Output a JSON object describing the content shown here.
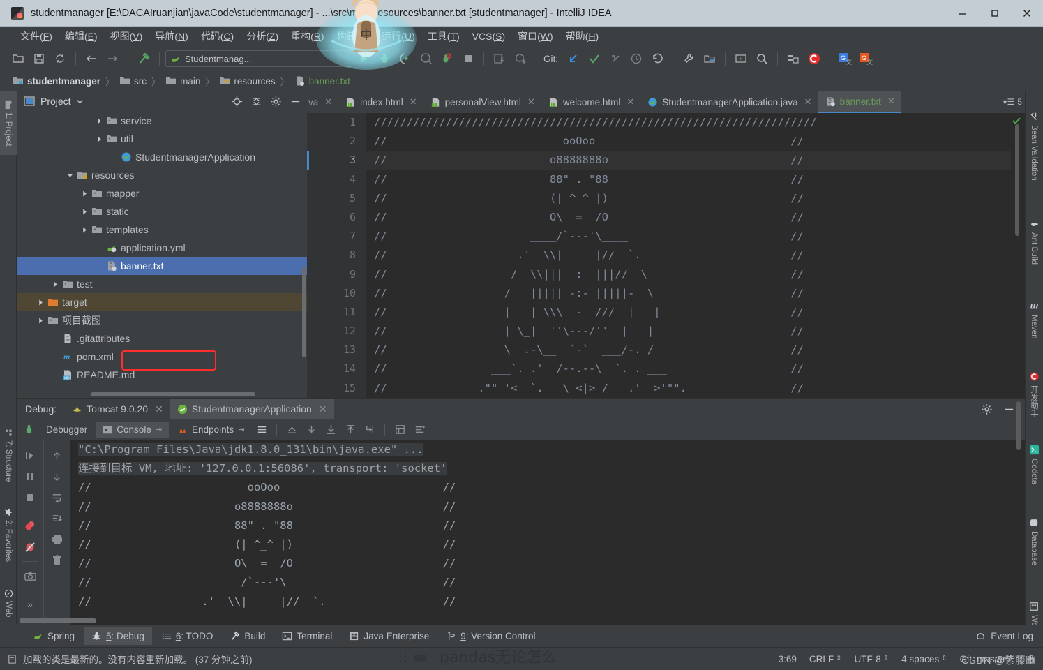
{
  "window": {
    "title": "studentmanager [E:\\DACAIruanjian\\javaCode\\studentmanager] - ...\\src\\main\\resources\\banner.txt [studentmanager] - IntelliJ IDEA",
    "minimize": "minimize-icon",
    "maximize": "maximize-icon",
    "close": "close-icon"
  },
  "menubar": [
    {
      "label": "文件(F)"
    },
    {
      "label": "编辑(E)"
    },
    {
      "label": "视图(V)"
    },
    {
      "label": "导航(N)"
    },
    {
      "label": "代码(C)"
    },
    {
      "label": "分析(Z)"
    },
    {
      "label": "重构(R)"
    },
    {
      "label": "构建(B)"
    },
    {
      "label": "运行(U)"
    },
    {
      "label": "工具(T)"
    },
    {
      "label": "VCS(S)"
    },
    {
      "label": "窗口(W)"
    },
    {
      "label": "帮助(H)"
    }
  ],
  "toolbar": {
    "run_configuration": "Studentmanag...",
    "git_label": "Git:"
  },
  "breadcrumbs": [
    {
      "label": "studentmanager",
      "style": "bold"
    },
    {
      "label": "src",
      "style": "normal"
    },
    {
      "label": "main",
      "style": "normal"
    },
    {
      "label": "resources",
      "style": "normal"
    },
    {
      "label": "banner.txt",
      "style": "green"
    }
  ],
  "left_stripe": [
    {
      "label": "1: Project",
      "active": true
    },
    {
      "label": "7: Structure",
      "active": false
    },
    {
      "label": "2: Favorites",
      "active": false
    },
    {
      "label": "Web",
      "active": false
    }
  ],
  "right_stripe": [
    {
      "label": "Bean Validation"
    },
    {
      "label": "Ant Build"
    },
    {
      "label": "Maven"
    },
    {
      "label": "开发助手"
    },
    {
      "label": "Codota"
    },
    {
      "label": "Database"
    },
    {
      "label": "Word Bo"
    }
  ],
  "project_panel": {
    "title": "Project",
    "tree": [
      {
        "label": "service",
        "indent": 5,
        "arrow": "right",
        "icon": "folder",
        "state": "normal"
      },
      {
        "label": "util",
        "indent": 5,
        "arrow": "right",
        "icon": "folder",
        "state": "normal"
      },
      {
        "label": "StudentmanagerApplication",
        "indent": 6,
        "arrow": "none",
        "icon": "spring-class",
        "state": "normal"
      },
      {
        "label": "resources",
        "indent": 3,
        "arrow": "down",
        "icon": "resources",
        "state": "normal"
      },
      {
        "label": "mapper",
        "indent": 4,
        "arrow": "right",
        "icon": "folder",
        "state": "normal"
      },
      {
        "label": "static",
        "indent": 4,
        "arrow": "right",
        "icon": "folder",
        "state": "normal"
      },
      {
        "label": "templates",
        "indent": 4,
        "arrow": "right",
        "icon": "folder",
        "state": "normal"
      },
      {
        "label": "application.yml",
        "indent": 5,
        "arrow": "none",
        "icon": "spring-yml",
        "state": "normal"
      },
      {
        "label": "banner.txt",
        "indent": 5,
        "arrow": "none",
        "icon": "spring-txt",
        "state": "selected"
      },
      {
        "label": "test",
        "indent": 2,
        "arrow": "right",
        "icon": "folder",
        "state": "normal"
      },
      {
        "label": "target",
        "indent": 1,
        "arrow": "right",
        "icon": "folder-orange",
        "state": "target"
      },
      {
        "label": "项目截图",
        "indent": 1,
        "arrow": "right",
        "icon": "folder",
        "state": "normal"
      },
      {
        "label": ".gitattributes",
        "indent": 2,
        "arrow": "none",
        "icon": "file",
        "state": "normal"
      },
      {
        "label": "pom.xml",
        "indent": 2,
        "arrow": "none",
        "icon": "maven",
        "state": "normal"
      },
      {
        "label": "README.md",
        "indent": 2,
        "arrow": "none",
        "icon": "markdown",
        "state": "normal"
      }
    ]
  },
  "editor": {
    "tabs": [
      {
        "label": "va",
        "icon": "java",
        "active": false,
        "clipped": true
      },
      {
        "label": "index.html",
        "icon": "html",
        "active": false
      },
      {
        "label": "personalView.html",
        "icon": "html",
        "active": false
      },
      {
        "label": "welcome.html",
        "icon": "html",
        "active": false
      },
      {
        "label": "StudentmanagerApplication.java",
        "icon": "spring-class",
        "active": false
      },
      {
        "label": "banner.txt",
        "icon": "spring-txt",
        "active": true
      }
    ],
    "tab_overflow_count": "5",
    "current_line": 3,
    "lines": [
      {
        "n": 1,
        "text": "////////////////////////////////////////////////////////////////////"
      },
      {
        "n": 2,
        "text": "//                          _ooOoo_                             //"
      },
      {
        "n": 3,
        "text": "//                         o8888888o                            //"
      },
      {
        "n": 4,
        "text": "//                         88\" . \"88                            //"
      },
      {
        "n": 5,
        "text": "//                         (| ^_^ |)                            //"
      },
      {
        "n": 6,
        "text": "//                         O\\  =  /O                            //"
      },
      {
        "n": 7,
        "text": "//                      ____/`---'\\____                         //"
      },
      {
        "n": 8,
        "text": "//                    .'  \\\\|     |//  `.                       //"
      },
      {
        "n": 9,
        "text": "//                   /  \\\\|||  :  |||//  \\                      //"
      },
      {
        "n": 10,
        "text": "//                  /  _||||| -:- |||||-  \\                     //"
      },
      {
        "n": 11,
        "text": "//                  |   | \\\\\\  -  ///  |   |                    //"
      },
      {
        "n": 12,
        "text": "//                  | \\_|  ''\\---/''  |   |                     //"
      },
      {
        "n": 13,
        "text": "//                  \\  .-\\__  `-`  ___/-. /                     //"
      },
      {
        "n": 14,
        "text": "//                ___`. .'  /--.--\\  `. . ___                   //"
      },
      {
        "n": 15,
        "text": "//              .\"\" '<  `.___\\_<|>_/___.'  >'\"\".                //"
      }
    ]
  },
  "debug": {
    "label": "Debug:",
    "sessions": [
      {
        "label": "Tomcat 9.0.20",
        "icon": "tomcat",
        "active": false
      },
      {
        "label": "StudentmanagerApplication",
        "icon": "spring",
        "active": true
      }
    ],
    "subtabs": [
      {
        "label": "Debugger",
        "icon": "",
        "active": false
      },
      {
        "label": "Console",
        "icon": "console-icon",
        "active": true
      },
      {
        "label": "Endpoints",
        "icon": "endpoints-icon",
        "active": false
      }
    ],
    "console_lines": [
      {
        "text": "\"C:\\Program Files\\Java\\jdk1.8.0_131\\bin\\java.exe\" ...",
        "type": "cmd"
      },
      {
        "text": "连接到目标 VM, 地址: '127.0.0.1:56086', transport: 'socket'",
        "type": "cmd"
      },
      {
        "text": "//                       _ooOoo_                        //",
        "type": "art"
      },
      {
        "text": "//                      o8888888o                       //",
        "type": "art"
      },
      {
        "text": "//                      88\" . \"88                       //",
        "type": "art"
      },
      {
        "text": "//                      (| ^_^ |)                       //",
        "type": "art"
      },
      {
        "text": "//                      O\\  =  /O                       //",
        "type": "art"
      },
      {
        "text": "//                   ____/`---'\\____                    //",
        "type": "art"
      },
      {
        "text": "//                 .'  \\\\|     |//  `.                  //",
        "type": "art"
      }
    ]
  },
  "bottom_tabs": [
    {
      "label": "Spring",
      "icon": "spring-leaf-icon",
      "active": false
    },
    {
      "label": "5: Debug",
      "icon": "bug-icon",
      "active": true
    },
    {
      "label": "6: TODO",
      "icon": "todo-icon",
      "active": false
    },
    {
      "label": "Build",
      "icon": "hammer-icon",
      "active": false
    },
    {
      "label": "Terminal",
      "icon": "terminal-icon",
      "active": false
    },
    {
      "label": "Java Enterprise",
      "icon": "java-ee-icon",
      "active": false
    },
    {
      "label": "9: Version Control",
      "icon": "vcs-icon",
      "active": false
    }
  ],
  "event_log": "Event Log",
  "statusbar": {
    "message": "加载的类是最新的。没有内容重新加载。 (37 分钟之前)",
    "caret": "3:69",
    "line_separator": "CRLF",
    "encoding": "UTF-8",
    "indent": "4 spaces",
    "branch": "Git: master"
  },
  "watermark": "CSDN @紫藤幽",
  "colors": {
    "accent_blue": "#4b6eaf",
    "titlebar": "#c5cdd4",
    "chrome": "#3c3f41",
    "editor_bg": "#2b2b2b",
    "code_fg": "#808a9a",
    "green_text": "#6a9c5a",
    "highlight_red": "#ff2d2d",
    "target_row": "#4f4733"
  }
}
